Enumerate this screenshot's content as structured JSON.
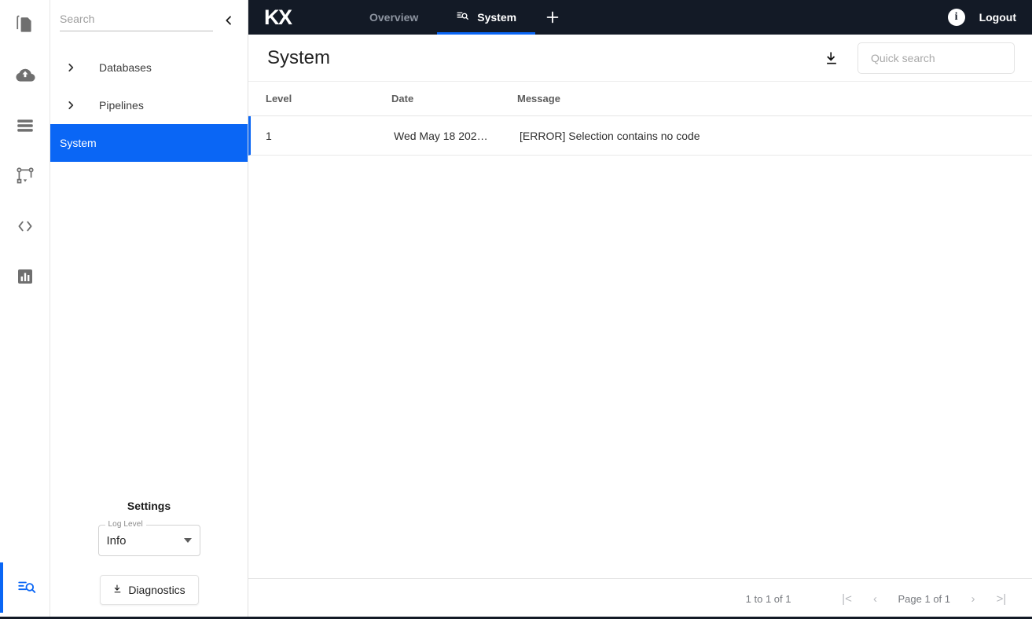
{
  "rail": {
    "icons": [
      {
        "name": "documents-icon"
      },
      {
        "name": "cloud-upload-icon"
      },
      {
        "name": "database-layers-icon"
      },
      {
        "name": "pipeline-icon"
      },
      {
        "name": "code-brackets-icon"
      },
      {
        "name": "chart-icon"
      }
    ],
    "bottom_icon": {
      "name": "log-search-icon"
    }
  },
  "explorer": {
    "search": {
      "value": "",
      "placeholder": "Search"
    },
    "collapse_icon": "chevron-left-icon",
    "tree": [
      {
        "label": "Databases",
        "expanded": false,
        "selected": false
      },
      {
        "label": "Pipelines",
        "expanded": false,
        "selected": false
      },
      {
        "label": "System",
        "expanded": false,
        "selected": true
      }
    ],
    "settings": {
      "title": "Settings",
      "log_level": {
        "label": "Log Level",
        "value": "Info"
      },
      "diagnostics_label": "Diagnostics"
    }
  },
  "topbar": {
    "logo": "KX",
    "tabs": [
      {
        "label": "Overview",
        "icon": null,
        "active": false
      },
      {
        "label": "System",
        "icon": "log-search-icon",
        "active": true
      }
    ],
    "add_tab_icon": "plus-icon",
    "info_label": "i",
    "logout_label": "Logout"
  },
  "page": {
    "title": "System",
    "download_icon": "download-icon",
    "quick_search": {
      "value": "",
      "placeholder": "Quick search"
    }
  },
  "table": {
    "columns": [
      "Level",
      "Date",
      "Message"
    ],
    "rows": [
      {
        "level": "1",
        "date": "Wed May 18 202…",
        "message": "[ERROR] Selection contains no code"
      }
    ],
    "footer": {
      "range": "1 to 1 of 1",
      "page": "Page 1 of 1",
      "first_icon": "|<",
      "prev_icon": "‹",
      "next_icon": "›",
      "last_icon": ">|"
    }
  },
  "colors": {
    "accent": "#0a66f5",
    "navy": "#131a26",
    "muted": "#76797e"
  }
}
